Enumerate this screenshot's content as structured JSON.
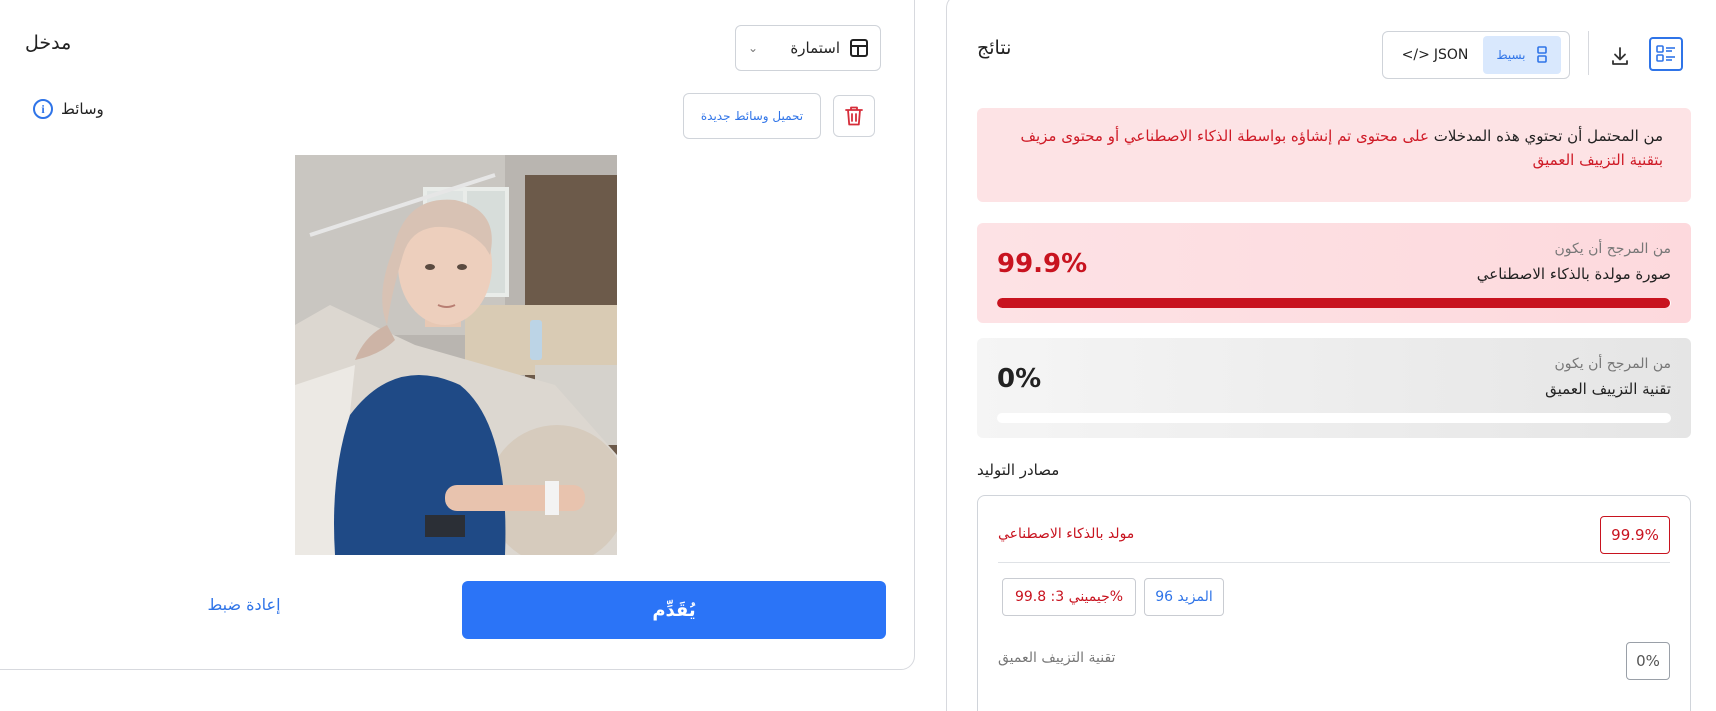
{
  "input": {
    "title": "مدخل",
    "mode_label": "استمارة",
    "media_label": "وسائط",
    "upload_label": "تحميل وسائط جديدة",
    "submit_label": "يُقَدِّم",
    "reset_label": "إعادة ضبط"
  },
  "results": {
    "title": "نتائج",
    "view_json_label": "JSON",
    "view_json_code": "</>",
    "view_simple_label": "بسيط",
    "alert_prefix": "من المحتمل أن تحتوي هذه المدخلات",
    "alert_rest": "على محتوى تم إنشاؤه بواسطة الذكاء الاصطناعي أو محتوى مزيف بتقنية التزييف العميق",
    "cards": [
      {
        "likely": "من المرجح أن يكون",
        "kind": "صورة مولدة بالذكاء الاصطناعي",
        "pct": "99.9%",
        "level": 0.999
      },
      {
        "likely": "من المرجح أن يكون",
        "kind": "تقنية التزييف العميق",
        "pct": "0%",
        "level": 0.0
      }
    ],
    "sources_title": "مصادر التوليد",
    "sources": {
      "ai_label": "مولد بالذكاء الاصطناعي",
      "ai_pct": "99.9%",
      "gemini_chip": "جيميني 3: 99.8%",
      "more_chip": "96 المزيد",
      "deepfake_label": "تقنية التزييف العميق",
      "deepfake_pct": "0%"
    }
  },
  "colors": {
    "accent": "#2b74f7",
    "danger": "#c8131f",
    "alert_bg": "#fde3e5"
  }
}
